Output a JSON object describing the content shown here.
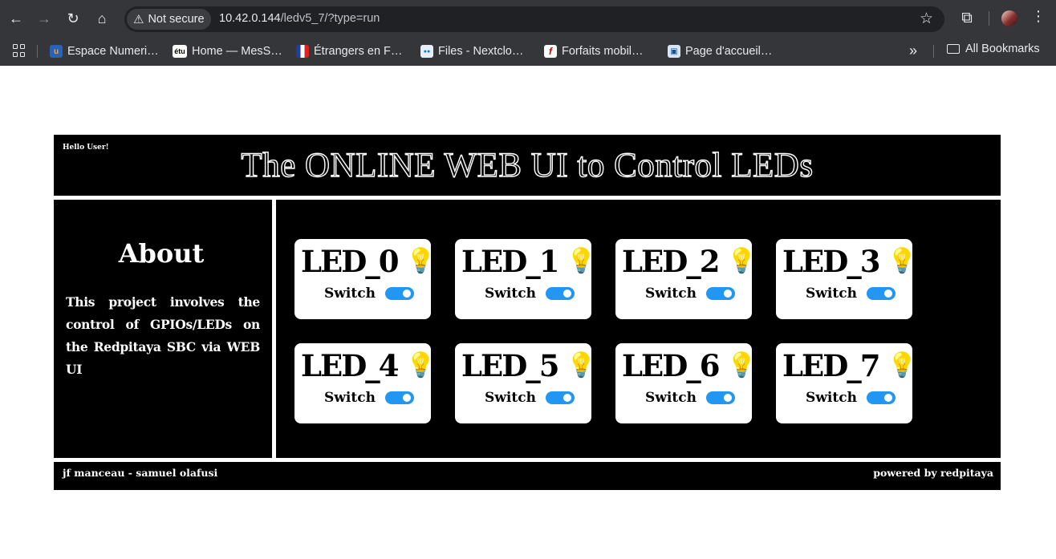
{
  "browser": {
    "security_label": "Not secure",
    "url_host": "10.42.0.144",
    "url_path": "/ledv5_7/?type=run",
    "bookmarks": [
      {
        "label": "Espace Numeri…",
        "icon": "u-favicon"
      },
      {
        "label": "Home — MesS…",
        "icon": "etu-favicon"
      },
      {
        "label": "Étrangers en F…",
        "icon": "french-flag-favicon"
      },
      {
        "label": "Files - Nextclo…",
        "icon": "nextcloud-favicon"
      },
      {
        "label": "Forfaits mobil…",
        "icon": "free-favicon"
      },
      {
        "label": "Page d'accueil…",
        "icon": "portal-favicon"
      }
    ],
    "all_bookmarks_label": "All Bookmarks"
  },
  "header": {
    "greeting": "Hello User!",
    "title": "The ONLINE WEB UI to Control LEDs"
  },
  "about": {
    "title": "About",
    "text": "This project involves the control of GPIOs/LEDs on the Redpitaya SBC via WEB UI"
  },
  "leds": [
    {
      "name": "LED_0",
      "switch_label": "Switch",
      "on": true
    },
    {
      "name": "LED_1",
      "switch_label": "Switch",
      "on": true
    },
    {
      "name": "LED_2",
      "switch_label": "Switch",
      "on": true
    },
    {
      "name": "LED_3",
      "switch_label": "Switch",
      "on": true
    },
    {
      "name": "LED_4",
      "switch_label": "Switch",
      "on": true
    },
    {
      "name": "LED_5",
      "switch_label": "Switch",
      "on": true
    },
    {
      "name": "LED_6",
      "switch_label": "Switch",
      "on": true
    },
    {
      "name": "LED_7",
      "switch_label": "Switch",
      "on": true
    }
  ],
  "footer": {
    "credits": "jf manceau - samuel olafusi",
    "powered_by": "powered by redpitaya"
  },
  "colors": {
    "background": "#000000",
    "card": "#ffffff",
    "toggle_on": "#2196f3"
  }
}
